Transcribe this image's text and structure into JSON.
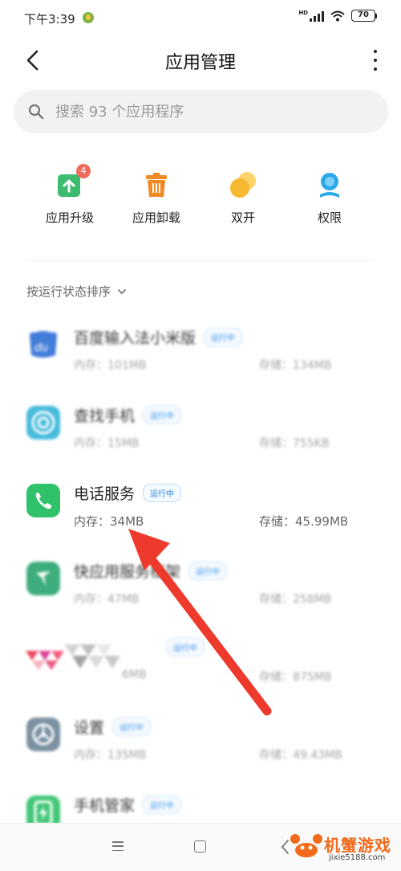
{
  "status_bar": {
    "time": "下午3:39",
    "battery": "70",
    "network": "HD"
  },
  "header": {
    "title": "应用管理"
  },
  "search": {
    "placeholder": "搜索 93 个应用程序"
  },
  "quick_actions": [
    {
      "label": "应用升级",
      "icon": "upgrade-icon",
      "badge": "4",
      "color": "#3dbb6f"
    },
    {
      "label": "应用卸载",
      "icon": "trash-icon",
      "color": "#f08a24"
    },
    {
      "label": "双开",
      "icon": "dual-app-icon",
      "color": "#f5b82e"
    },
    {
      "label": "权限",
      "icon": "permission-icon",
      "color": "#29a9e8"
    }
  ],
  "sort": {
    "label": "按运行状态排序"
  },
  "running_label": "运行中",
  "apps": [
    {
      "name": "百度输入法小米版",
      "memory": "内存：101MB",
      "storage": "存储：134MB",
      "icon": "baidu-input-icon"
    },
    {
      "name": "查找手机",
      "memory": "内存：15MB",
      "storage": "存储：755KB",
      "icon": "find-phone-icon"
    },
    {
      "name": "电话服务",
      "memory": "内存：34MB",
      "storage": "存储：45.99MB",
      "icon": "phone-icon"
    },
    {
      "name": "快应用服务框架",
      "memory": "内存：47MB",
      "storage": "存储：258MB",
      "icon": "quick-app-icon"
    },
    {
      "name": "",
      "memory": "6MB",
      "storage": "存储：875MB",
      "icon": "pixelated-app-icon"
    },
    {
      "name": "设置",
      "memory": "内存：135MB",
      "storage": "存储：49.43MB",
      "icon": "settings-icon"
    },
    {
      "name": "手机管家",
      "memory": "",
      "storage": "",
      "icon": "security-icon"
    }
  ],
  "watermark": {
    "title": "机蟹游戏",
    "url": "jixie5188.com"
  }
}
